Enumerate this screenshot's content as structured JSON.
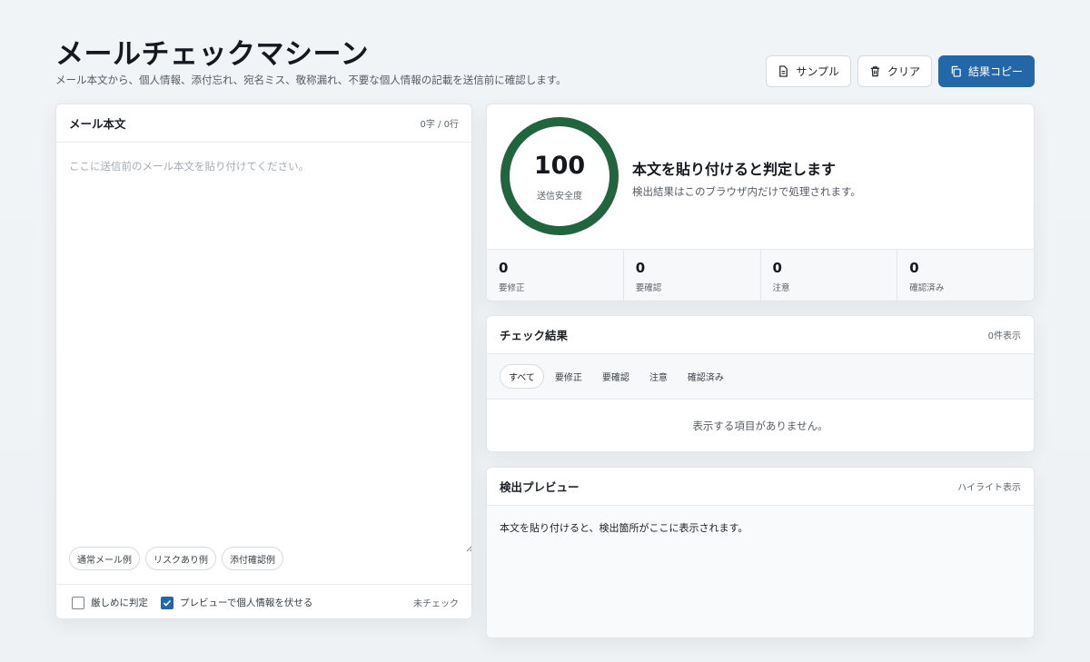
{
  "header": {
    "title": "メールチェックマシーン",
    "subtitle": "メール本文から、個人情報、添付忘れ、宛名ミス、敬称漏れ、不要な個人情報の記載を送信前に確認します。"
  },
  "toolbar": {
    "sample_label": "サンプル",
    "clear_label": "クリア",
    "copy_label": "結果コピー"
  },
  "editor": {
    "title": "メール本文",
    "counter": "0字 / 0行",
    "value": "",
    "placeholder": "ここに送信前のメール本文を貼り付けてください。",
    "presets": [
      "通常メール例",
      "リスクあり例",
      "添付確認例"
    ],
    "options": [
      {
        "label": "厳しめに判定",
        "checked": false
      },
      {
        "label": "プレビューで個人情報を伏せる",
        "checked": true
      }
    ],
    "status": "未チェック"
  },
  "score": {
    "value": "100",
    "label": "送信安全度",
    "ratio": 1.0,
    "color": "#21653f",
    "verdict_title": "本文を貼り付けると判定します",
    "verdict_sub": "検出結果はこのブラウザ内だけで処理されます。"
  },
  "stats": [
    {
      "value": "0",
      "label": "要修正"
    },
    {
      "value": "0",
      "label": "要確認"
    },
    {
      "value": "0",
      "label": "注意"
    },
    {
      "value": "0",
      "label": "確認済み"
    }
  ],
  "results": {
    "title": "チェック結果",
    "count": "0件表示",
    "tabs": [
      "すべて",
      "要修正",
      "要確認",
      "注意",
      "確認済み"
    ],
    "active_tab": "すべて",
    "empty": "表示する項目がありません。"
  },
  "preview": {
    "title": "検出プレビュー",
    "mode": "ハイライト表示",
    "body": "本文を貼り付けると、検出箇所がここに表示されます。"
  },
  "colors": {
    "accent": "#2467a8",
    "gauge": "#21653f"
  }
}
